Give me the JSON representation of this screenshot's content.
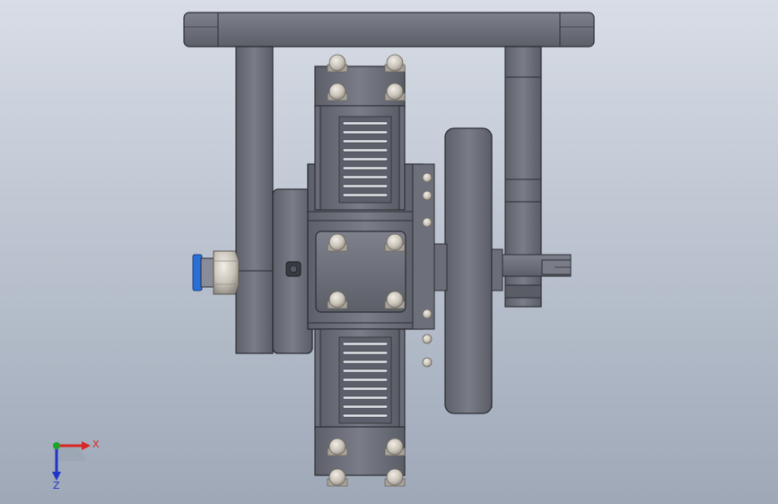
{
  "viewport": {
    "background_top": "#d8dde6",
    "background_bottom": "#9ea8b7",
    "part_color": "#6e717d",
    "part_dark": "#4a4c55",
    "part_light": "#8a8d99",
    "bolt_color": "#c9c4bc",
    "fitting_ring": "#2a6fd6"
  },
  "triad": {
    "x_label": "X",
    "z_label": "Z",
    "x_color": "#d62828",
    "y_color": "#1fa32a",
    "z_color": "#2036c8"
  }
}
